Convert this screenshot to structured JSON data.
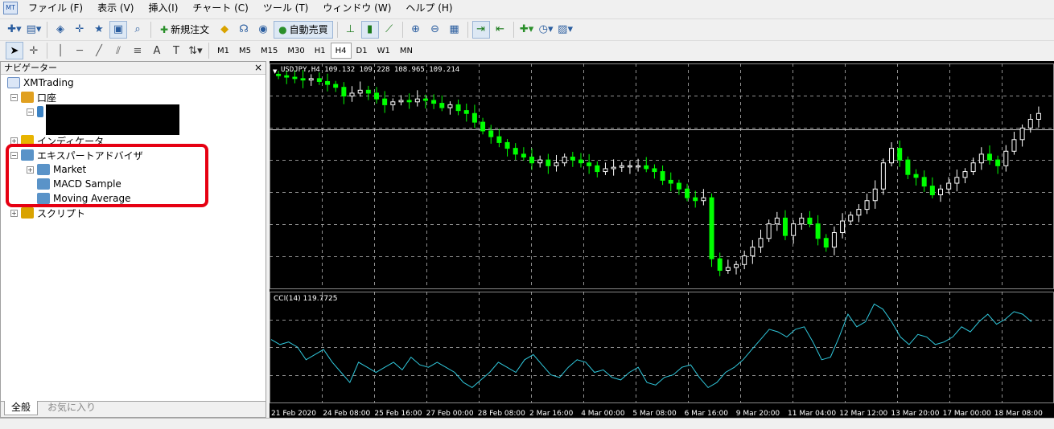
{
  "menu": [
    "ファイル (F)",
    "表示 (V)",
    "挿入(I)",
    "チャート (C)",
    "ツール (T)",
    "ウィンドウ (W)",
    "ヘルプ (H)"
  ],
  "toolbar": {
    "new_order": "新規注文",
    "auto_trading": "自動売買"
  },
  "timeframes": [
    "M1",
    "M5",
    "M15",
    "M30",
    "H1",
    "H4",
    "D1",
    "W1",
    "MN"
  ],
  "active_timeframe": "H4",
  "navigator": {
    "title": "ナビゲーター",
    "close": "×",
    "root": "XMTrading",
    "accounts": "口座",
    "indicators": "インディケータ",
    "experts": "エキスパートアドバイザ",
    "expert_items": [
      "Market",
      "MACD Sample",
      "Moving Average"
    ],
    "scripts": "スクリプト",
    "tabs": [
      "全般",
      "お気に入り"
    ]
  },
  "chart": {
    "header": "USDJPY,H4  109.132 109.228 108.965 109.214",
    "cci_label": "CCI(14) 119.7725",
    "time_labels": [
      "21 Feb 2020",
      "24 Feb 08:00",
      "25 Feb 16:00",
      "27 Feb 00:00",
      "28 Feb 08:00",
      "2 Mar 16:00",
      "4 Mar 00:00",
      "5 Mar 08:00",
      "6 Mar 16:00",
      "9 Mar 20:00",
      "11 Mar 04:00",
      "12 Mar 12:00",
      "13 Mar 20:00",
      "17 Mar 00:00",
      "18 Mar 08:00"
    ],
    "colors": {
      "background": "#000000",
      "bull": "#ffffff",
      "bear": "#00ff00",
      "grid": "#b4b4b4",
      "cci_line": "#30c8dc",
      "highlight": "#e60012"
    }
  },
  "chart_data": {
    "type": "candlestick",
    "symbol": "USDJPY",
    "timeframe": "H4",
    "ohlc_header": [
      109.132,
      109.228,
      108.965,
      109.214
    ],
    "close_series": [
      111.9,
      111.85,
      111.8,
      111.75,
      111.8,
      111.7,
      111.6,
      111.5,
      111.2,
      111.3,
      111.4,
      111.3,
      111.1,
      110.9,
      111.0,
      111.05,
      111.0,
      111.1,
      111.05,
      110.95,
      110.8,
      110.9,
      110.7,
      110.6,
      110.3,
      110.0,
      109.8,
      109.6,
      109.4,
      109.2,
      109.1,
      108.9,
      109.0,
      108.8,
      108.9,
      109.1,
      109.0,
      108.9,
      108.8,
      108.6,
      108.7,
      108.75,
      108.8,
      108.8,
      108.8,
      108.7,
      108.6,
      108.3,
      108.2,
      108.0,
      107.7,
      107.6,
      107.7,
      105.6,
      105.2,
      105.3,
      105.4,
      105.7,
      106.0,
      106.3,
      106.8,
      107.0,
      106.4,
      106.8,
      107.0,
      106.8,
      106.3,
      106.0,
      106.5,
      106.9,
      107.1,
      107.3,
      107.6,
      108.0,
      108.9,
      109.4,
      109.0,
      108.5,
      108.4,
      108.1,
      107.8,
      108.0,
      108.2,
      108.4,
      108.6,
      108.9,
      109.2,
      109.0,
      108.8,
      109.3,
      109.7,
      110.1,
      110.4,
      110.6
    ],
    "cci_series": [
      50,
      30,
      40,
      20,
      -30,
      -10,
      10,
      -40,
      -80,
      -120,
      -40,
      -60,
      -80,
      -60,
      -40,
      -70,
      -20,
      -50,
      -60,
      -40,
      -60,
      -80,
      -120,
      -140,
      -110,
      -80,
      -40,
      -60,
      -80,
      -30,
      -10,
      -50,
      -90,
      -100,
      -60,
      -30,
      -40,
      -80,
      -70,
      -100,
      -110,
      -80,
      -60,
      -120,
      -130,
      -100,
      -90,
      -60,
      -50,
      -100,
      -140,
      -120,
      -80,
      -60,
      -30,
      10,
      50,
      90,
      80,
      60,
      90,
      100,
      40,
      -30,
      -20,
      60,
      150,
      100,
      120,
      190,
      170,
      120,
      60,
      30,
      70,
      60,
      30,
      40,
      60,
      100,
      80,
      120,
      150,
      110,
      130,
      160,
      150,
      120
    ],
    "cci_value": 119.7725,
    "x_labels": [
      "21 Feb 2020",
      "24 Feb 08:00",
      "25 Feb 16:00",
      "27 Feb 00:00",
      "28 Feb 08:00",
      "2 Mar 16:00",
      "4 Mar 00:00",
      "5 Mar 08:00",
      "6 Mar 16:00",
      "9 Mar 20:00",
      "11 Mar 04:00",
      "12 Mar 12:00",
      "13 Mar 20:00",
      "17 Mar 00:00",
      "18 Mar 08:00"
    ]
  }
}
